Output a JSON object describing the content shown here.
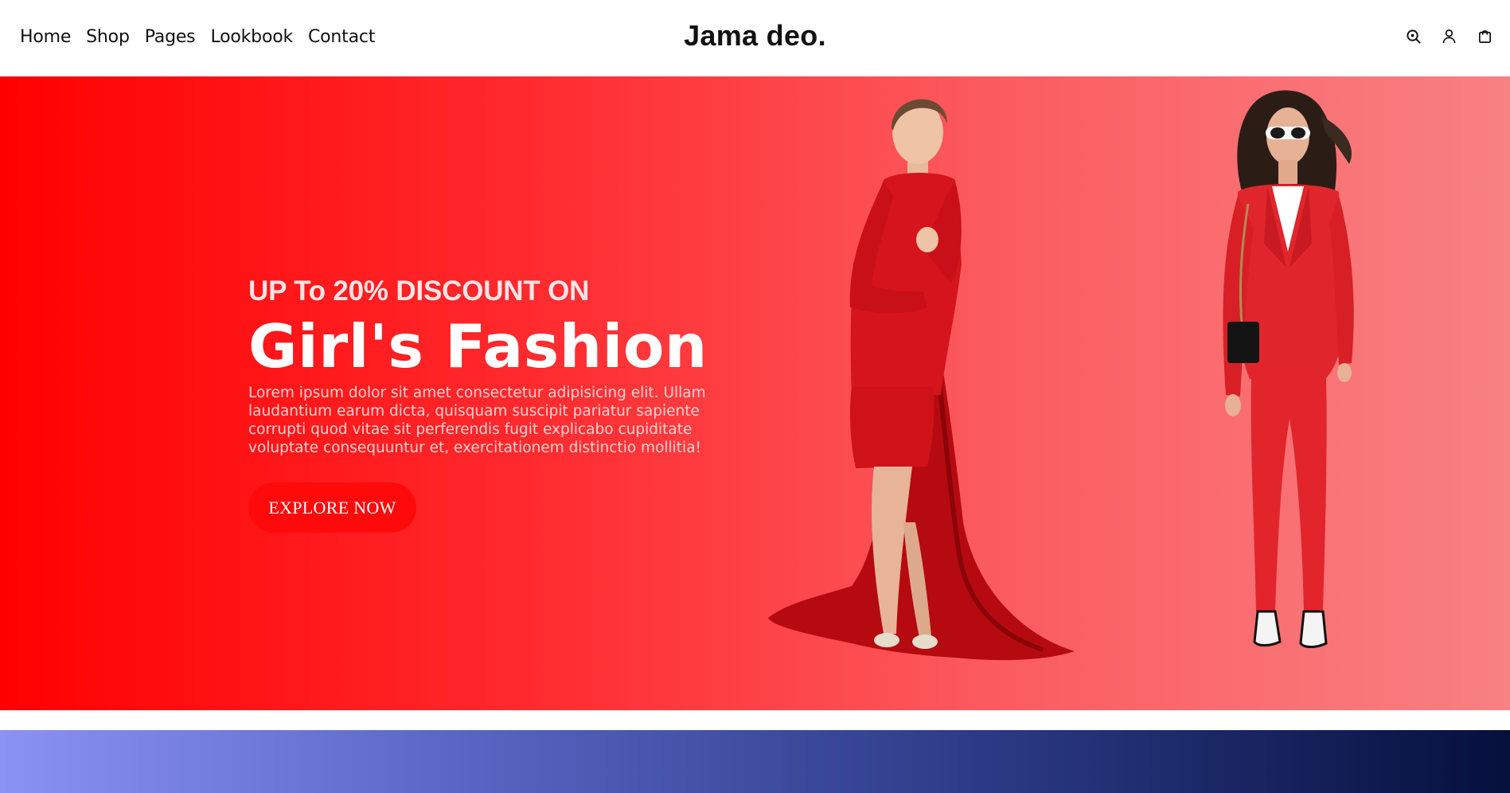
{
  "header": {
    "nav": [
      "Home",
      "Shop",
      "Pages",
      "Lookbook",
      "Contact"
    ],
    "brand": "Jama deo.",
    "icons": [
      "search-icon",
      "user-icon",
      "cart-icon"
    ]
  },
  "hero": {
    "eyebrow": "UP To 20% DISCOUNT ON",
    "headline": "Girl's Fashion",
    "description": "Lorem ipsum dolor sit amet consectetur adipisicing elit. Ullam laudantium earum dicta, quisquam suscipit pariatur sapiente corrupti quod vitae sit perferendis fugit explicabo cupiditate voluptate consequuntur et, exercitationem distinctio mollitia!",
    "cta_label": "EXPLORE NOW",
    "images": [
      "model-red-dress",
      "model-red-suit"
    ]
  },
  "colors": {
    "accent": "#ff0a0a",
    "hero_start": "#ff0000",
    "hero_end": "#f88183",
    "banner_start": "#8a92f4",
    "banner_end": "#05103c"
  }
}
